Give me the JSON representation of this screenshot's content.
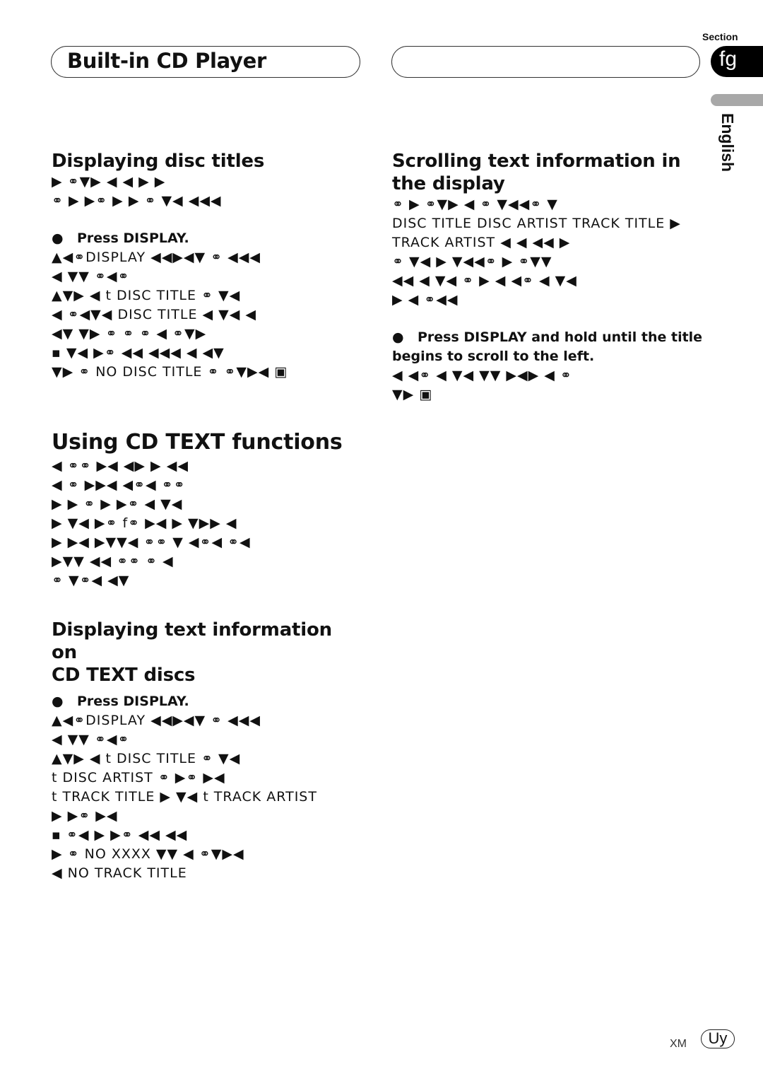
{
  "header": {
    "title": "Built-in CD Player",
    "section_label": "Section",
    "section_number": "fg",
    "language": "English"
  },
  "left": {
    "s1": {
      "title": "Displaying disc titles",
      "lines": [
        "▶ ⚭▼▶ ◀ ◀ ▶ ▶",
        "⚭ ▶ ▶⚭ ▶ ▶ ⚭ ▼◀ ◀◀◀"
      ],
      "step": "Press DISPLAY.",
      "body": [
        "▲◀⚭DISPLAY ◀◀▶◀▼ ⚭ ◀◀◀",
        "◀ ▼▼ ⚭◀⚭",
        "▲▼▶ ◀ t  DISC TITLE ⚭ ▼◀",
        "◀ ⚭◀▼◀       DISC TITLE ◀ ▼◀ ◀",
        "◀▼ ▼▶ ⚭ ⚭ ⚭ ◀ ⚭▼▶",
        "▪   ▼◀ ▶⚭ ◀◀ ◀◀◀ ◀ ◀▼",
        "▼▶ ⚭        NO DISC TITLE ⚭ ⚭▼▶◀ ▣"
      ]
    },
    "s2": {
      "title": "Using CD TEXT functions",
      "lines": [
        "◀ ⚭⚭ ▶◀ ◀▶ ▶ ◀◀",
        " ◀ ⚭  ▶▶◀ ◀⚭◀ ⚭⚭",
        "▶ ▶ ⚭ ▶ ▶⚭ ◀  ▼◀",
        "▶ ▼◀ ▶⚭     f⚭ ▶◀ ▶ ▼▶▶ ◀",
        "▶ ▶◀ ▶▼▼◀  ⚭⚭ ▼ ◀⚭◀ ⚭◀",
        "▶▼▼ ◀◀  ⚭⚭ ⚭ ◀",
        "⚭ ▼⚭◀ ◀▼"
      ]
    },
    "s3": {
      "title_line1": "Displaying text information on",
      "title_line2": "CD TEXT discs",
      "step": "Press DISPLAY.",
      "body": [
        "▲◀⚭DISPLAY ◀◀▶◀▼ ⚭ ◀◀◀",
        "◀ ▼▼ ⚭◀⚭",
        "▲▼▶ ◀ t  DISC TITLE ⚭ ▼◀",
        "t  DISC ARTIST ⚭ ▶⚭ ▶◀",
        "t  TRACK TITLE ▶ ▼◀      t  TRACK ARTIST",
        "▶ ▶⚭ ▶◀",
        "▪   ⚭◀ ▶ ▶⚭  ◀◀ ◀◀",
        " ▶  ⚭                NO XXXX ▼▼ ◀ ⚭▼▶◀",
        "◀    NO TRACK TITLE"
      ]
    }
  },
  "right": {
    "s1": {
      "title_line1": "Scrolling text information in",
      "title_line2": "the display",
      "body": [
        "⚭  ▶ ⚭▼▶ ◀ ⚭  ▼◀◀⚭ ▼",
        "DISC TITLE  DISC ARTIST  TRACK TITLE ▶",
        "TRACK ARTIST ◀ ◀ ◀◀ ▶",
        " ⚭ ▼◀ ▶  ▼◀◀⚭  ▶ ⚭▼▼",
        "◀◀  ◀ ▼◀ ⚭ ▶ ◀ ◀⚭  ◀ ▼◀",
        "▶ ◀ ⚭◀◀"
      ],
      "step_line1": "Press DISPLAY and hold until the title",
      "step_line2": "begins to scroll to the left.",
      "after": [
        "◀ ◀⚭  ◀ ▼◀ ▼▼ ▶◀▶  ◀ ⚭",
        "▼▶  ▣"
      ]
    }
  },
  "footer": {
    "model": "XM",
    "page": "Uy"
  }
}
